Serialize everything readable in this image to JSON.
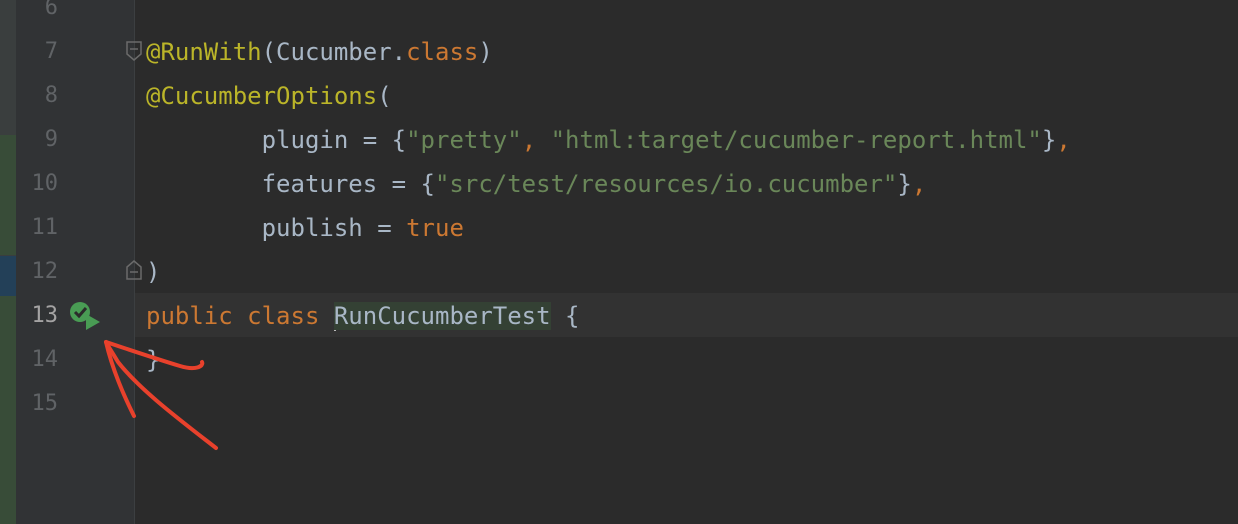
{
  "editor": {
    "current_line": 13,
    "lines": [
      {
        "no": "6",
        "segments": []
      },
      {
        "no": "7",
        "segments": [
          {
            "t": "@RunWith",
            "c": "ann"
          },
          {
            "t": "(Cucumber.",
            "c": "plain"
          },
          {
            "t": "class",
            "c": "kw"
          },
          {
            "t": ")",
            "c": "plain"
          }
        ]
      },
      {
        "no": "8",
        "segments": [
          {
            "t": "@CucumberOptions",
            "c": "ann"
          },
          {
            "t": "(",
            "c": "plain"
          }
        ]
      },
      {
        "no": "9",
        "segments": [
          {
            "t": "        plugin = {",
            "c": "plain"
          },
          {
            "t": "\"pretty\"",
            "c": "str"
          },
          {
            "t": ", ",
            "c": "kw"
          },
          {
            "t": "\"html:target/cucumber-report.html\"",
            "c": "str"
          },
          {
            "t": "}",
            "c": "plain"
          },
          {
            "t": ",",
            "c": "kw"
          }
        ]
      },
      {
        "no": "10",
        "segments": [
          {
            "t": "        features = {",
            "c": "plain"
          },
          {
            "t": "\"src/test/resources/io.cucumber\"",
            "c": "str"
          },
          {
            "t": "}",
            "c": "plain"
          },
          {
            "t": ",",
            "c": "kw"
          }
        ]
      },
      {
        "no": "11",
        "segments": [
          {
            "t": "        publish = ",
            "c": "plain"
          },
          {
            "t": "true",
            "c": "kw"
          }
        ]
      },
      {
        "no": "12",
        "segments": [
          {
            "t": ")",
            "c": "plain"
          }
        ]
      },
      {
        "no": "13",
        "segments": [
          {
            "t": "public class ",
            "c": "kw"
          },
          {
            "t": "RunCucumberTest",
            "c": "plain classname",
            "caret": true
          },
          {
            "t": " {",
            "c": "plain"
          }
        ]
      },
      {
        "no": "14",
        "segments": [
          {
            "t": "}",
            "c": "plain"
          }
        ]
      },
      {
        "no": "15",
        "segments": []
      }
    ]
  },
  "icons": {
    "run_gutter": "run-test-passed-icon",
    "fold_start": "fold-start-icon",
    "fold_end": "fold-end-icon"
  },
  "colors": {
    "background": "#2b2b2b",
    "annotation": "#bbb529",
    "keyword": "#cc7832",
    "string": "#6a8759",
    "identifier": "#a9b7c6",
    "run_icon": "#499c54",
    "overlay_arrow": "#e8412c"
  }
}
